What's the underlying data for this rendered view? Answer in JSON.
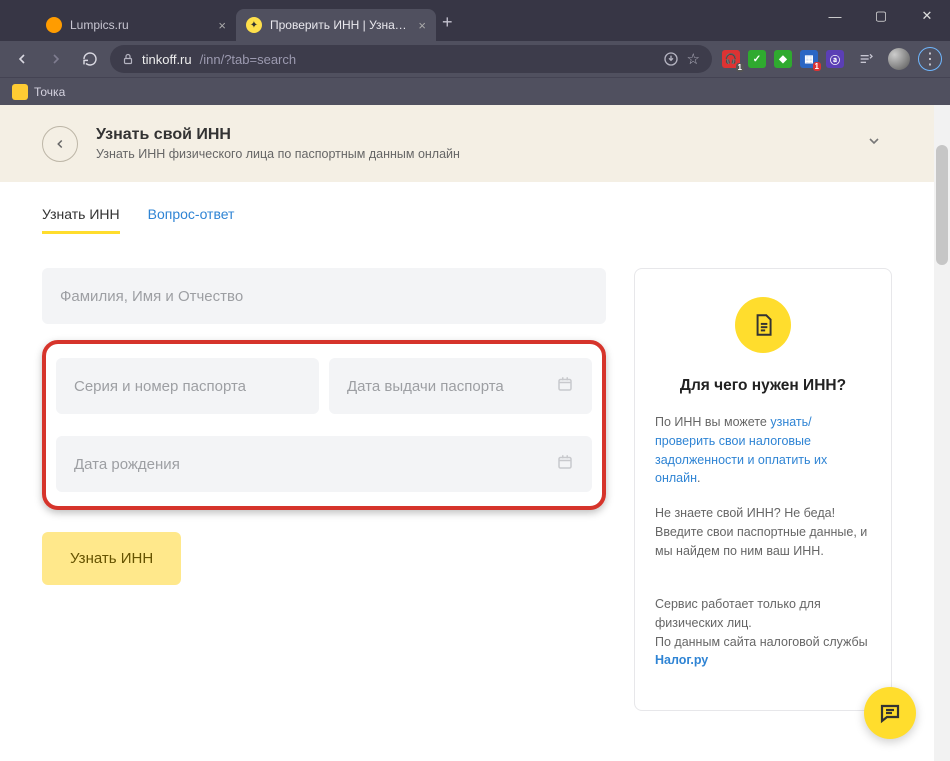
{
  "browser": {
    "tabs": [
      {
        "title": "Lumpics.ru"
      },
      {
        "title": "Проверить ИНН | Узнать свой И",
        "active": true
      }
    ],
    "url_host": "tinkoff.ru",
    "url_path": "/inn/?tab=search",
    "bookmarks": [
      {
        "label": "Точка"
      }
    ]
  },
  "banner": {
    "title": "Узнать свой ИНН",
    "subtitle": "Узнать ИНН физического лица по паспортным данным онлайн"
  },
  "page_tabs": {
    "main": "Узнать ИНН",
    "faq": "Вопрос-ответ"
  },
  "form": {
    "fio_placeholder": "Фамилия, Имя и Отчество",
    "passport_placeholder": "Серия и номер паспорта",
    "issue_date_placeholder": "Дата выдачи паспорта",
    "dob_placeholder": "Дата рождения",
    "submit_label": "Узнать ИНН"
  },
  "sidebar": {
    "heading": "Для чего нужен ИНН?",
    "p1_prefix": "По ИНН вы можете ",
    "p1_link": "узнать/ проверить свои налоговые задолженности и оплатить их онлайн",
    "p1_suffix": ".",
    "p2": "Не знаете свой ИНН? Не беда! Введите свои паспортные данные, и мы найдем по ним ваш ИНН.",
    "p3_prefix": "Сервис работает только для физических лиц.\nПо данным сайта налоговой службы ",
    "p3_link": "Налог.ру"
  }
}
